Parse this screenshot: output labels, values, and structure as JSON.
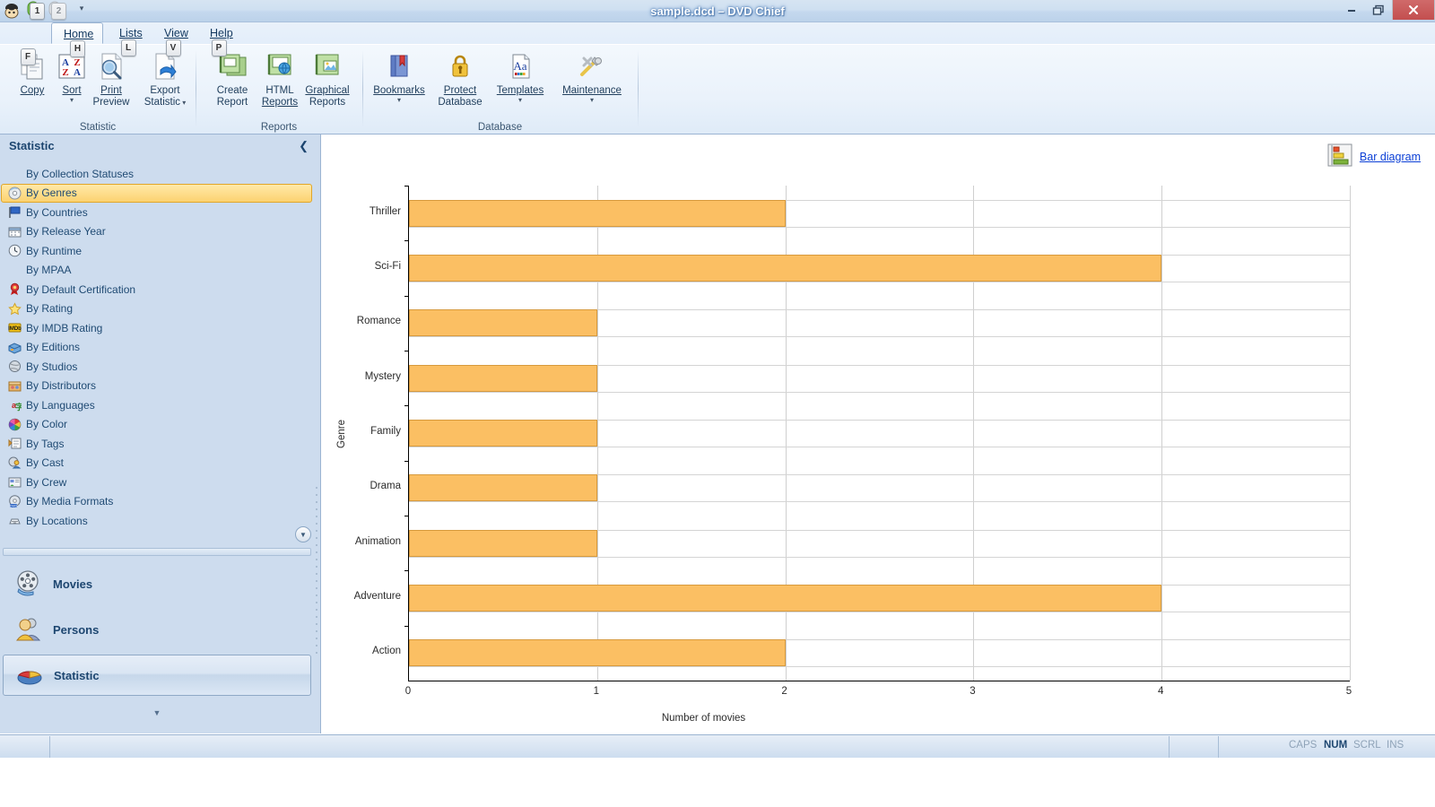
{
  "window": {
    "title": "sample.dcd – DVD Chief",
    "minimize": "Minimize",
    "maximize": "Restore",
    "close": "Close"
  },
  "quick_access": {
    "keytips": [
      "1",
      "2"
    ],
    "more_label": "▾"
  },
  "ribbon": {
    "tabs": [
      {
        "id": "file",
        "label": "",
        "key": "F",
        "active": false
      },
      {
        "id": "home",
        "label": "Home",
        "key": "H",
        "active": true
      },
      {
        "id": "lists",
        "label": "Lists",
        "key": "L",
        "active": false
      },
      {
        "id": "view",
        "label": "View",
        "key": "V",
        "active": false
      },
      {
        "id": "help",
        "label": "Help",
        "key": "P",
        "active": false
      }
    ],
    "groups": [
      {
        "name": "Statistic",
        "buttons": [
          {
            "label_line1": "Copy",
            "label_line2": "",
            "icon": "copy-icon",
            "has_caret": false
          },
          {
            "label_line1": "Sort",
            "label_line2": "",
            "icon": "sort-az-icon",
            "has_caret": true
          },
          {
            "label_line1": "Print",
            "label_line2": "Preview",
            "icon": "print-preview-icon",
            "has_caret": false
          },
          {
            "label_line1": "Export",
            "label_line2": "Statistic",
            "icon": "export-statistic-icon",
            "has_caret": true
          }
        ]
      },
      {
        "name": "Reports",
        "buttons": [
          {
            "label_line1": "Create",
            "label_line2": "Report",
            "icon": "create-report-icon",
            "has_caret": false
          },
          {
            "label_line1": "HTML",
            "label_line2": "Reports",
            "icon": "html-reports-icon",
            "has_caret": false
          },
          {
            "label_line1": "Graphical",
            "label_line2": "Reports",
            "icon": "graphical-reports-icon",
            "has_caret": false
          }
        ]
      },
      {
        "name": "Database",
        "buttons": [
          {
            "label_line1": "Bookmarks",
            "label_line2": "",
            "icon": "bookmarks-icon",
            "has_caret": true
          },
          {
            "label_line1": "Protect",
            "label_line2": "Database",
            "icon": "protect-database-icon",
            "has_caret": false
          },
          {
            "label_line1": "Templates",
            "label_line2": "",
            "icon": "templates-icon",
            "has_caret": true
          },
          {
            "label_line1": "Maintenance",
            "label_line2": "",
            "icon": "maintenance-icon",
            "has_caret": true
          }
        ]
      }
    ]
  },
  "sidebar": {
    "title": "Statistic",
    "collapse_glyph": "❮",
    "scroll_down_glyph": "▼",
    "items": [
      {
        "label": "By Collection Statuses",
        "icon": "none",
        "selected": false
      },
      {
        "label": "By Genres",
        "icon": "disc-icon",
        "selected": true
      },
      {
        "label": "By Countries",
        "icon": "flag-icon",
        "selected": false
      },
      {
        "label": "By Release Year",
        "icon": "calendar-icon",
        "selected": false
      },
      {
        "label": "By Runtime",
        "icon": "clock-icon",
        "selected": false
      },
      {
        "label": "By MPAA",
        "icon": "none",
        "selected": false
      },
      {
        "label": "By Default Certification",
        "icon": "ribbon-award-icon",
        "selected": false
      },
      {
        "label": "By Rating",
        "icon": "star-icon",
        "selected": false
      },
      {
        "label": "By IMDB Rating",
        "icon": "imdb-icon",
        "selected": false
      },
      {
        "label": "By Editions",
        "icon": "box-icon",
        "selected": false
      },
      {
        "label": "By Studios",
        "icon": "studio-icon",
        "selected": false
      },
      {
        "label": "By Distributors",
        "icon": "distributor-icon",
        "selected": false
      },
      {
        "label": "By Languages",
        "icon": "languages-icon",
        "selected": false
      },
      {
        "label": "By Color",
        "icon": "color-wheel-icon",
        "selected": false
      },
      {
        "label": "By Tags",
        "icon": "tags-icon",
        "selected": false
      },
      {
        "label": "By Cast",
        "icon": "cast-icon",
        "selected": false
      },
      {
        "label": "By Crew",
        "icon": "crew-icon",
        "selected": false
      },
      {
        "label": "By Media Formats",
        "icon": "dvd-icon",
        "selected": false
      },
      {
        "label": "By Locations",
        "icon": "location-drawer-icon",
        "selected": false
      }
    ],
    "nav": [
      {
        "label": "Movies",
        "icon": "film-reel-icon",
        "active": false
      },
      {
        "label": "Persons",
        "icon": "people-icon",
        "active": false
      },
      {
        "label": "Statistic",
        "icon": "pie-chart-icon",
        "active": true
      }
    ],
    "nav_more_glyph": "▼"
  },
  "content": {
    "bar_diagram_link": "Bar diagram",
    "bar_diagram_icon": "bar-diagram-icon"
  },
  "chart_data": {
    "type": "bar",
    "orientation": "horizontal",
    "title": "",
    "xlabel": "Number of movies",
    "ylabel": "Genre",
    "categories": [
      "Thriller",
      "Sci-Fi",
      "Romance",
      "Mystery",
      "Family",
      "Drama",
      "Animation",
      "Adventure",
      "Action"
    ],
    "values": [
      2,
      4,
      1,
      1,
      1,
      1,
      1,
      4,
      2
    ],
    "xticks": [
      0,
      1,
      2,
      3,
      4,
      5
    ],
    "xlim": [
      0,
      5
    ],
    "grid": true,
    "legend": "none",
    "bar_color": "#fbbf63",
    "bar_border_color": "#d79a3d"
  },
  "statusbar": {
    "indicators": [
      {
        "label": "CAPS",
        "active": false
      },
      {
        "label": "NUM",
        "active": true
      },
      {
        "label": "SCRL",
        "active": false
      },
      {
        "label": "INS",
        "active": false
      }
    ]
  }
}
